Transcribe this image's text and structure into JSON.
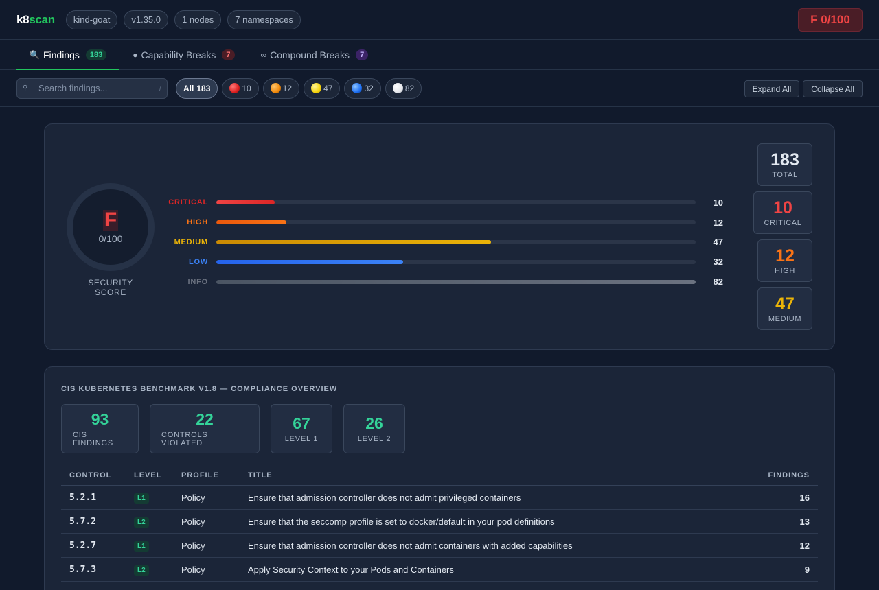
{
  "header": {
    "brand_main": "k8",
    "brand_accent": "scan",
    "pills": [
      "kind-goat",
      "v1.35.0",
      "1 nodes",
      "7 namespaces"
    ],
    "grade_badge": "F 0/100"
  },
  "tabs": [
    {
      "icon": "magnifier-icon",
      "label": "Findings",
      "count": "183"
    },
    {
      "icon": "bomb-icon",
      "label": "Capability Breaks",
      "count": "7"
    },
    {
      "icon": "chain-link-icon",
      "label": "Compound Breaks",
      "count": "7"
    }
  ],
  "filters": {
    "search_placeholder": "Search findings...",
    "search_shortcut": "/",
    "all_label": "All",
    "all_count": "183",
    "severity_chips": [
      {
        "name": "critical",
        "count": "10",
        "color": "#ef4444"
      },
      {
        "name": "high",
        "count": "12",
        "color": "#f59e0b"
      },
      {
        "name": "medium",
        "count": "47",
        "color": "#facc15"
      },
      {
        "name": "low",
        "count": "32",
        "color": "#3b82f6"
      },
      {
        "name": "info",
        "count": "82",
        "color": "#e5e7eb"
      }
    ],
    "expand_all": "Expand All",
    "collapse_all": "Collapse All"
  },
  "score": {
    "grade": "F",
    "value": "0/100",
    "label": "SECURITY SCORE",
    "total_findings": 183,
    "bars": [
      {
        "label": "CRITICAL",
        "value": 10,
        "color": "#ef4444",
        "color2": "#dc2626"
      },
      {
        "label": "HIGH",
        "value": 12,
        "color": "#ea580c",
        "color2": "#f97316"
      },
      {
        "label": "MEDIUM",
        "value": 47,
        "color": "#ca8a04",
        "color2": "#eab308"
      },
      {
        "label": "LOW",
        "value": 32,
        "color": "#2563eb",
        "color2": "#3b82f6"
      },
      {
        "label": "INFO",
        "value": 82,
        "color": "#4b5563",
        "color2": "#6b7280"
      }
    ],
    "stats": [
      {
        "n": "183",
        "l": "TOTAL",
        "color": "#e2e8f0"
      },
      {
        "n": "10",
        "l": "CRITICAL",
        "color": "#ef4444"
      },
      {
        "n": "12",
        "l": "HIGH",
        "color": "#f97316"
      },
      {
        "n": "47",
        "l": "MEDIUM",
        "color": "#eab308"
      }
    ]
  },
  "cis": {
    "title": "CIS KUBERNETES BENCHMARK V1.8 — COMPLIANCE OVERVIEW",
    "boxes": [
      {
        "n": "93",
        "l": "CIS FINDINGS"
      },
      {
        "n": "22",
        "l": "CONTROLS VIOLATED"
      },
      {
        "n": "67",
        "l": "LEVEL 1"
      },
      {
        "n": "26",
        "l": "LEVEL 2"
      }
    ],
    "columns": [
      "CONTROL",
      "LEVEL",
      "PROFILE",
      "TITLE",
      "FINDINGS"
    ],
    "rows": [
      {
        "control": "5.2.1",
        "level": "L1",
        "profile": "Policy",
        "title": "Ensure that admission controller does not admit privileged containers",
        "findings": "16"
      },
      {
        "control": "5.7.2",
        "level": "L2",
        "profile": "Policy",
        "title": "Ensure that the seccomp profile is set to docker/default in your pod definitions",
        "findings": "13"
      },
      {
        "control": "5.2.7",
        "level": "L1",
        "profile": "Policy",
        "title": "Ensure that admission controller does not admit containers with added capabilities",
        "findings": "12"
      },
      {
        "control": "5.7.3",
        "level": "L2",
        "profile": "Policy",
        "title": "Apply Security Context to your Pods and Containers",
        "findings": "9"
      }
    ]
  }
}
